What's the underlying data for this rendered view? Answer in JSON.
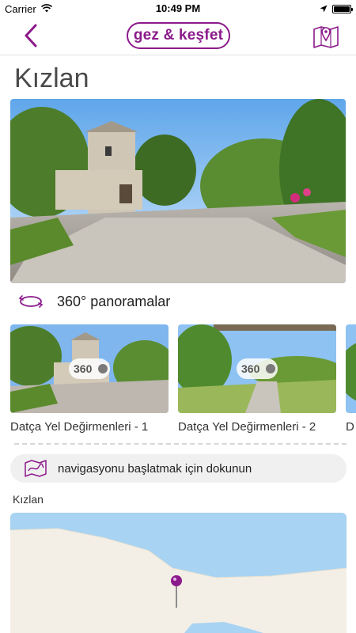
{
  "status": {
    "carrier": "Carrier",
    "time": "10:49 PM",
    "battery_level": 1.0
  },
  "header": {
    "logo_text": "gez & keşfet",
    "back_icon": "chevron-left-icon",
    "map_icon": "map-pin-icon",
    "accent_color": "#8b1a8b"
  },
  "page": {
    "title": "Kızlan"
  },
  "panorama_section": {
    "label": "360° panoramalar",
    "icon": "rotate-360-icon",
    "items": [
      {
        "caption": "Datça Yel Değirmenleri - 1",
        "badge": "360"
      },
      {
        "caption": "Datça Yel Değirmenleri - 2",
        "badge": "360"
      },
      {
        "caption": "D"
      }
    ]
  },
  "navigation": {
    "label": "navigasyonu başlatmak için dokunun",
    "icon": "route-map-icon"
  },
  "map_section": {
    "label": "Kızlan",
    "pin_color": "#8b1a8b"
  }
}
